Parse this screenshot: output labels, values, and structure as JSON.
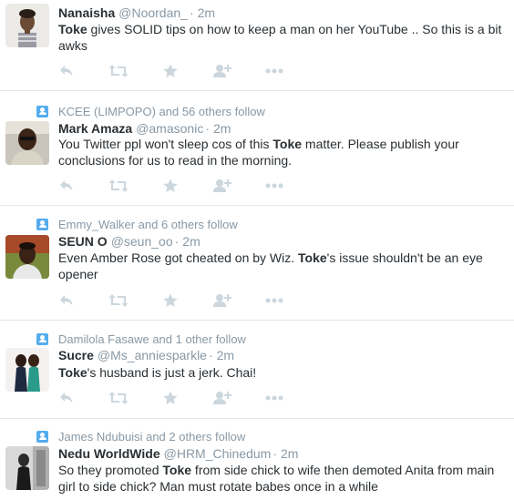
{
  "tweets": [
    {
      "context": "",
      "fullname": "Nanaisha",
      "username": "@Noordan_",
      "separator": "·",
      "time": "2m",
      "text_segments": [
        {
          "text": "Toke",
          "bold": true
        },
        {
          "text": " gives SOLID tips on how to keep a man on her YouTube .. So this is a bit awks",
          "bold": false
        }
      ]
    },
    {
      "context": "KCEE (LIMPOPO) and 56 others follow",
      "fullname": "Mark Amaza",
      "username": "@amasonic",
      "separator": "·",
      "time": "2m",
      "text_segments": [
        {
          "text": "You Twitter ppl won't sleep cos of this ",
          "bold": false
        },
        {
          "text": "Toke",
          "bold": true
        },
        {
          "text": " matter. Please publish your conclusions for us to read in the morning.",
          "bold": false
        }
      ]
    },
    {
      "context": "Emmy_Walker and 6 others follow",
      "fullname": "SEUN O",
      "username": "@seun_oo",
      "separator": "·",
      "time": "2m",
      "text_segments": [
        {
          "text": "Even Amber Rose got cheated on by Wiz. ",
          "bold": false
        },
        {
          "text": "Toke",
          "bold": true
        },
        {
          "text": "'s issue shouldn't be an eye opener",
          "bold": false
        }
      ]
    },
    {
      "context": "Damilola Fasawe and 1 other follow",
      "fullname": "Sucre",
      "username": "@Ms_anniesparkle",
      "separator": "·",
      "time": "2m",
      "text_segments": [
        {
          "text": "Toke",
          "bold": true
        },
        {
          "text": "'s husband is just a jerk. Chai!",
          "bold": false
        }
      ]
    },
    {
      "context": "James Ndubuisi and 2 others follow",
      "fullname": "Nedu WorldWide",
      "username": "@HRM_Chinedum",
      "separator": "·",
      "time": "2m",
      "text_segments": [
        {
          "text": "So they promoted ",
          "bold": false
        },
        {
          "text": "Toke",
          "bold": true
        },
        {
          "text": " from side chick to wife then demoted Anita from main girl to side chick? Man must rotate babes once in a while",
          "bold": false
        }
      ]
    }
  ],
  "actions": [
    "reply-icon",
    "retweet-icon",
    "favorite-icon",
    "follow-icon",
    "more-icon"
  ],
  "colors": {
    "name": "#292f33",
    "meta": "#8899a6",
    "icon": "#ccd6dd",
    "accent": "#55acee",
    "divider": "#e1e8ed"
  }
}
